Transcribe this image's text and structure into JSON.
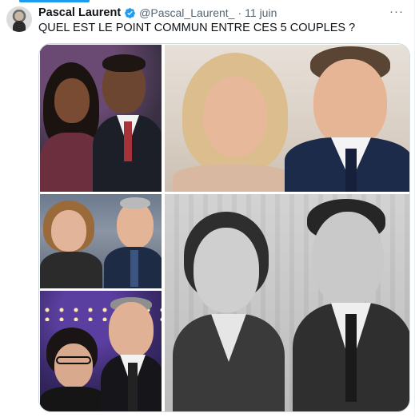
{
  "tweet": {
    "author_name": "Pascal Laurent",
    "handle": "@Pascal_Laurent_",
    "separator": "·",
    "date": "11 juin",
    "more_label": "···",
    "text": "QUEL EST LE POINT COMMUN ENTRE CES 5 COUPLES ?"
  },
  "icons": {
    "verified": "verified-badge-icon",
    "more": "more-options-icon"
  },
  "colors": {
    "accent": "#1d9bf0",
    "text_primary": "#0f1419",
    "text_secondary": "#536471",
    "border": "#cfd9de"
  }
}
